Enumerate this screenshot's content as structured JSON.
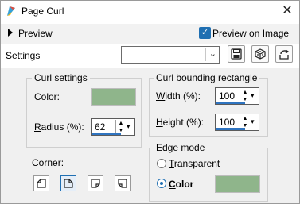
{
  "window": {
    "title": "Page Curl",
    "close_glyph": "✕"
  },
  "preview": {
    "label": "Preview",
    "preview_on_image_label": "Preview on Image",
    "preview_on_image_checked": true
  },
  "settings": {
    "label": "Settings",
    "combo_value": ""
  },
  "toolbar": {
    "icons": [
      "save-preset-icon",
      "randomize-icon",
      "reset-icon"
    ]
  },
  "curl_settings": {
    "title": "Curl settings",
    "color_label": "Color:",
    "color_value": "#8fb58b",
    "radius_label": "Radius (%):",
    "radius_value": "62",
    "corner_label": "Corner:",
    "corner_selected_index": 1
  },
  "bounding": {
    "title": "Curl bounding rectangle",
    "width_label": "Width (%):",
    "width_value": "100",
    "height_label": "Height (%):",
    "height_value": "100"
  },
  "edge_mode": {
    "title": "Edge mode",
    "transparent_label": "Transparent",
    "color_label": "Color",
    "selected": "color",
    "color_value": "#8fb58b"
  }
}
